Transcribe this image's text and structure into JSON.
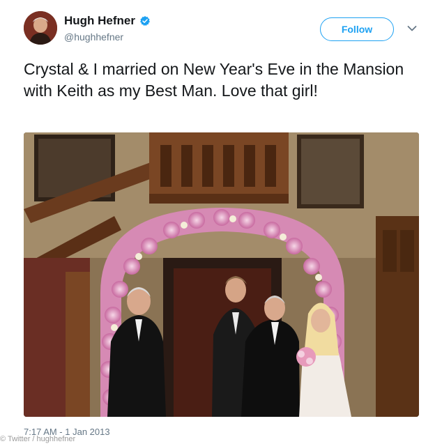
{
  "user": {
    "name": "Hugh Hefner",
    "handle": "@hughhefner",
    "verified_icon": "verified-badge-icon"
  },
  "actions": {
    "follow_label": "Follow",
    "menu_icon": "chevron-down-icon"
  },
  "tweet": {
    "text": "Crystal & I married on New Year's Eve in the Mansion with Keith as my Best Man. Love that girl!",
    "timestamp": "7:17 AM - 1 Jan 2013"
  },
  "photo": {
    "credit": "© Twitter / hughhefner"
  },
  "colors": {
    "accent": "#1da1f2",
    "text": "#14171a",
    "secondary_text": "#657786"
  }
}
